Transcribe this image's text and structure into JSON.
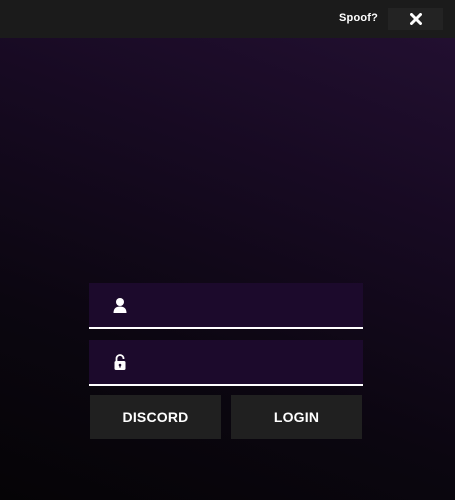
{
  "titlebar": {
    "title": "Spoof?",
    "close_icon": "close-x-icon"
  },
  "login_form": {
    "username": {
      "icon": "user-icon",
      "value": "",
      "placeholder": ""
    },
    "password": {
      "icon": "padlock-icon",
      "value": "",
      "placeholder": ""
    },
    "discord_label": "DISCORD",
    "login_label": "LOGIN"
  },
  "colors": {
    "titlebar_bg": "#1b1b1b",
    "field_bg": "#1c0a2c",
    "button_bg": "#202020",
    "accent_line": "#ffffff",
    "text": "#ffffff"
  }
}
